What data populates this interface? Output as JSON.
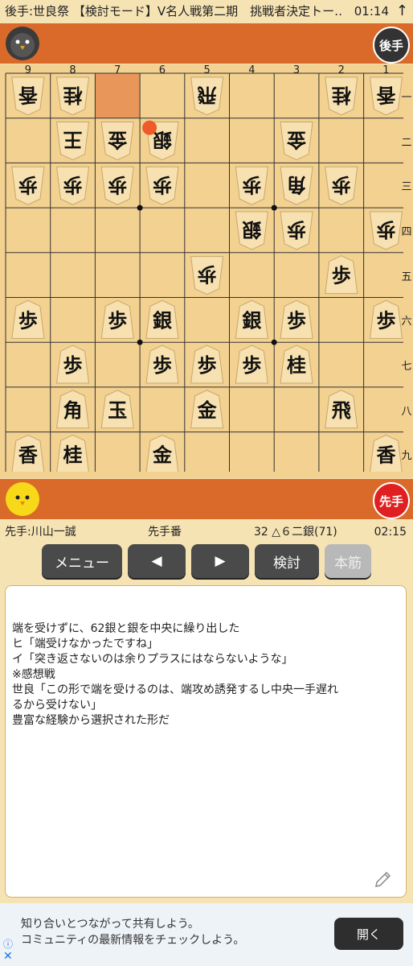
{
  "status_bar": {
    "title": "後手:世良祭 【検討モード】V名人戦第二期　挑戦者決定トー…",
    "clock": "01:14",
    "arrow": "↑"
  },
  "gote": {
    "badge": "後手"
  },
  "sente": {
    "badge": "先手"
  },
  "board": {
    "files": [
      "9",
      "8",
      "7",
      "6",
      "5",
      "4",
      "3",
      "2",
      "1"
    ],
    "ranks": [
      "一",
      "二",
      "三",
      "四",
      "五",
      "六",
      "七",
      "八",
      "九"
    ],
    "pieces": [
      {
        "owner": "gote",
        "kind": "香",
        "file": 9,
        "rank": 1
      },
      {
        "owner": "gote",
        "kind": "桂",
        "file": 8,
        "rank": 1
      },
      {
        "owner": "gote",
        "kind": "飛",
        "file": 5,
        "rank": 1
      },
      {
        "owner": "gote",
        "kind": "桂",
        "file": 2,
        "rank": 1
      },
      {
        "owner": "gote",
        "kind": "香",
        "file": 1,
        "rank": 1
      },
      {
        "owner": "gote",
        "kind": "王",
        "file": 8,
        "rank": 2
      },
      {
        "owner": "gote",
        "kind": "金",
        "file": 7,
        "rank": 2
      },
      {
        "owner": "gote",
        "kind": "銀",
        "file": 6,
        "rank": 2
      },
      {
        "owner": "gote",
        "kind": "金",
        "file": 3,
        "rank": 2
      },
      {
        "owner": "gote",
        "kind": "歩",
        "file": 9,
        "rank": 3
      },
      {
        "owner": "gote",
        "kind": "歩",
        "file": 8,
        "rank": 3
      },
      {
        "owner": "gote",
        "kind": "歩",
        "file": 7,
        "rank": 3
      },
      {
        "owner": "gote",
        "kind": "歩",
        "file": 6,
        "rank": 3
      },
      {
        "owner": "gote",
        "kind": "歩",
        "file": 4,
        "rank": 3
      },
      {
        "owner": "gote",
        "kind": "角",
        "file": 3,
        "rank": 3
      },
      {
        "owner": "gote",
        "kind": "歩",
        "file": 2,
        "rank": 3
      },
      {
        "owner": "gote",
        "kind": "銀",
        "file": 4,
        "rank": 4
      },
      {
        "owner": "gote",
        "kind": "歩",
        "file": 3,
        "rank": 4
      },
      {
        "owner": "gote",
        "kind": "歩",
        "file": 1,
        "rank": 4
      },
      {
        "owner": "gote",
        "kind": "歩",
        "file": 5,
        "rank": 5
      },
      {
        "owner": "sente",
        "kind": "歩",
        "file": 2,
        "rank": 5
      },
      {
        "owner": "sente",
        "kind": "歩",
        "file": 9,
        "rank": 6
      },
      {
        "owner": "sente",
        "kind": "歩",
        "file": 7,
        "rank": 6
      },
      {
        "owner": "sente",
        "kind": "銀",
        "file": 6,
        "rank": 6
      },
      {
        "owner": "sente",
        "kind": "銀",
        "file": 4,
        "rank": 6
      },
      {
        "owner": "sente",
        "kind": "歩",
        "file": 3,
        "rank": 6
      },
      {
        "owner": "sente",
        "kind": "歩",
        "file": 1,
        "rank": 6
      },
      {
        "owner": "sente",
        "kind": "歩",
        "file": 8,
        "rank": 7
      },
      {
        "owner": "sente",
        "kind": "歩",
        "file": 6,
        "rank": 7
      },
      {
        "owner": "sente",
        "kind": "歩",
        "file": 5,
        "rank": 7
      },
      {
        "owner": "sente",
        "kind": "歩",
        "file": 4,
        "rank": 7
      },
      {
        "owner": "sente",
        "kind": "桂",
        "file": 3,
        "rank": 7
      },
      {
        "owner": "sente",
        "kind": "角",
        "file": 8,
        "rank": 8
      },
      {
        "owner": "sente",
        "kind": "玉",
        "file": 7,
        "rank": 8
      },
      {
        "owner": "sente",
        "kind": "金",
        "file": 5,
        "rank": 8
      },
      {
        "owner": "sente",
        "kind": "飛",
        "file": 2,
        "rank": 8
      },
      {
        "owner": "sente",
        "kind": "香",
        "file": 9,
        "rank": 9
      },
      {
        "owner": "sente",
        "kind": "桂",
        "file": 8,
        "rank": 9
      },
      {
        "owner": "sente",
        "kind": "金",
        "file": 6,
        "rank": 9
      },
      {
        "owner": "sente",
        "kind": "香",
        "file": 1,
        "rank": 9
      }
    ],
    "last_move_from": {
      "file": 7,
      "rank": 1
    },
    "last_move_to": {
      "file": 6,
      "rank": 2
    },
    "colors": {
      "board": "#f2d191",
      "highlight": "#e8965a",
      "marker": "#ee5a2a",
      "piece": "#f7e1b0"
    }
  },
  "info": {
    "sente_name": "先手:川山一誠",
    "turn": "先手番",
    "move": "32 △６二銀(71)",
    "time": "02:15"
  },
  "buttons": {
    "menu": "メニュー",
    "prev": "◀",
    "next": "▶",
    "analyze": "検討",
    "mainline": "本筋"
  },
  "comment": "端を受けずに、62銀と銀を中央に繰り出した\nヒ「端受けなかったですね」\nイ「突き返さないのは余りプラスにはならないような」\n※感想戦\n世良「この形で端を受けるのは、端攻め誘発するし中央一手遅れ\nるから受けない」\n豊富な経験から選択された形だ",
  "ad": {
    "line1": "知り合いとつながって共有しよう。",
    "line2": "コミュニティの最新情報をチェックしよう。",
    "open": "開く"
  }
}
